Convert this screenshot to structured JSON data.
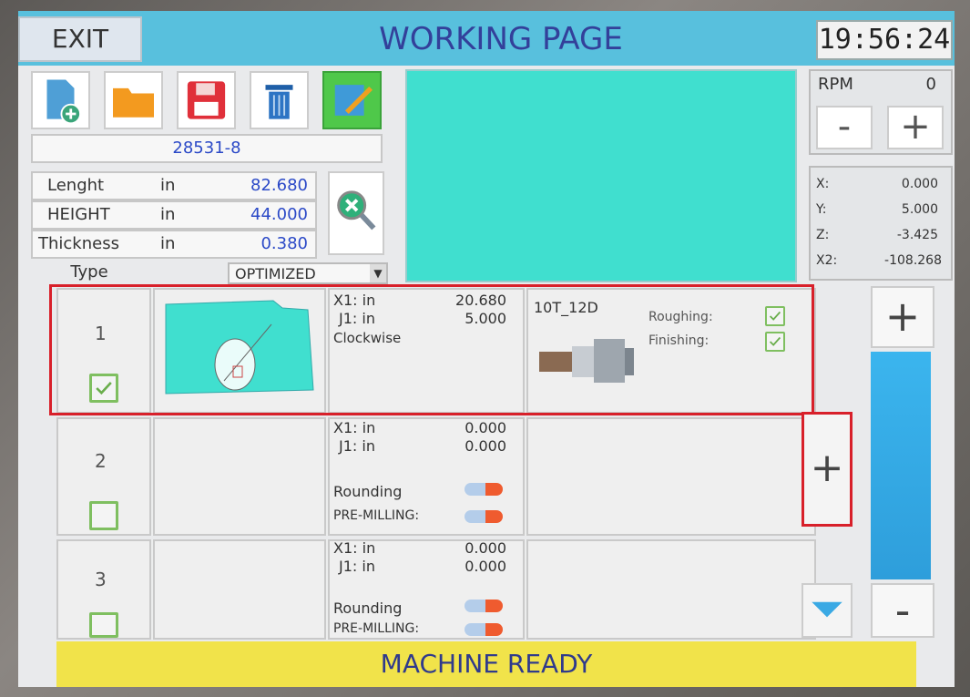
{
  "header": {
    "exit_label": "EXIT",
    "title": "WORKING PAGE",
    "time": "19:56:24"
  },
  "toolbar": {
    "icons": [
      "new-file-icon",
      "open-folder-icon",
      "save-icon",
      "trash-icon",
      "edit-icon"
    ]
  },
  "program_name": "28531-8",
  "dimensions": {
    "length_label": "Lenght",
    "length_unit": "in",
    "length_value": "82.680",
    "height_label": "HEIGHT",
    "height_unit": "in",
    "height_value": "44.000",
    "thickness_label": "Thickness",
    "thickness_unit": "in",
    "thickness_value": "0.380",
    "type_label": "Type",
    "type_value": "OPTIMIZED"
  },
  "rpm": {
    "label": "RPM",
    "value": "0",
    "minus": "-",
    "plus": "+"
  },
  "coords": [
    {
      "label": "X:",
      "value": "0.000"
    },
    {
      "label": "Y:",
      "value": "5.000"
    },
    {
      "label": "Z:",
      "value": "-3.425"
    },
    {
      "label": "X2:",
      "value": "-108.268"
    }
  ],
  "operations": [
    {
      "number": "1",
      "checked": true,
      "x1_label": "X1: in",
      "x1_value": "20.680",
      "j1_label": "J1: in",
      "j1_value": "5.000",
      "direction": "Clockwise",
      "tool": "10T_12D",
      "roughing_label": "Roughing:",
      "finishing_label": "Finishing:"
    },
    {
      "number": "2",
      "checked": false,
      "x1_label": "X1: in",
      "x1_value": "0.000",
      "j1_label": "J1: in",
      "j1_value": "0.000",
      "rounding_label": "Rounding",
      "premilling_label": "PRE-MILLING:"
    },
    {
      "number": "3",
      "checked": false,
      "x1_label": "X1: in",
      "x1_value": "0.000",
      "j1_label": "J1: in",
      "j1_value": "0.000",
      "rounding_label": "Rounding",
      "premilling_label": "PRE-MILLING:"
    }
  ],
  "side": {
    "plus_top": "+",
    "add_op": "+",
    "minus_bottom": "-"
  },
  "status": "MACHINE READY",
  "colors": {
    "header": "#58c0dd",
    "preview": "#40dfcf",
    "status_bar": "#f1e34a",
    "highlight": "#d8202a",
    "value_blue": "#2b49c7"
  }
}
